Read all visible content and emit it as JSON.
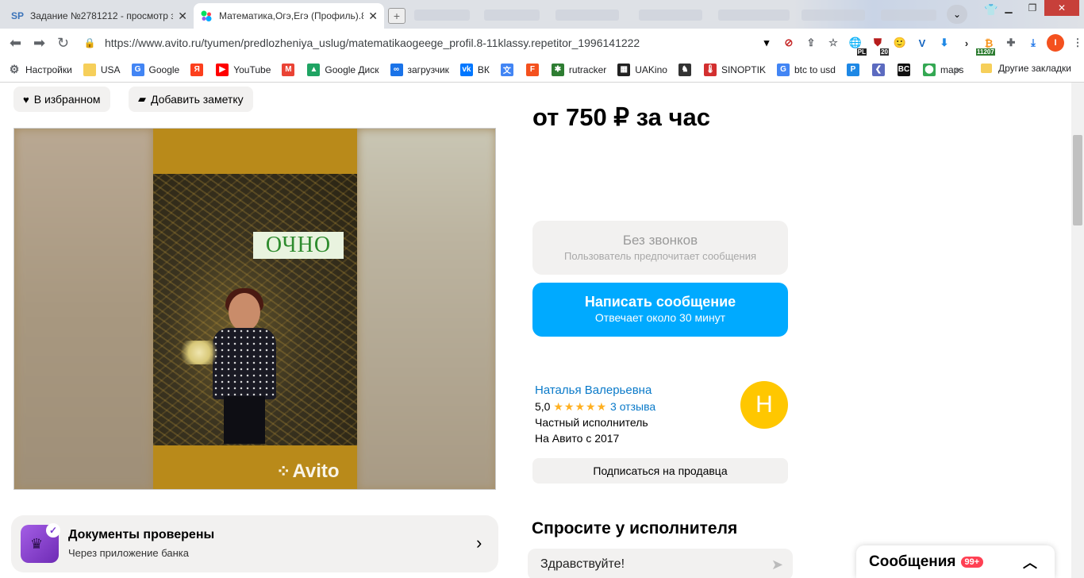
{
  "browser": {
    "tabs": [
      {
        "label": "Задание №2781212 - просмотр з",
        "favicon": "SP",
        "active": false
      },
      {
        "label": "Математика,Огэ,Егэ (Профиль).8-",
        "favicon": "avito-dots",
        "active": true
      }
    ],
    "url": "https://www.avito.ru/tyumen/predlozheniya_uslug/matematikaogeege_profil.8-11klassy.repetitor_1996141222",
    "extension_badges": {
      "pl": "PL",
      "twenty": "20",
      "count": "11207"
    },
    "profile_initial": "I",
    "bookmarks": [
      {
        "label": "Настройки",
        "icon": "gear-icon",
        "color": "#5f6368"
      },
      {
        "label": "USA",
        "icon": "folder-icon",
        "color": "#f6cf5a"
      },
      {
        "label": "Google",
        "icon": "google-icon",
        "color": "#4285f4"
      },
      {
        "label": "",
        "icon": "yandex-icon",
        "color": "#fc3f1d"
      },
      {
        "label": "YouTube",
        "icon": "youtube-icon",
        "color": "#ff0000"
      },
      {
        "label": "",
        "icon": "gmail-icon",
        "color": "#ea4335"
      },
      {
        "label": "Google Диск",
        "icon": "drive-icon",
        "color": "#1fa463"
      },
      {
        "label": "загрузчик",
        "icon": "infinity-icon",
        "color": "#1a73e8"
      },
      {
        "label": "ВК",
        "icon": "vk-icon",
        "color": "#0077ff"
      },
      {
        "label": "",
        "icon": "translate-icon",
        "color": "#4285f4"
      },
      {
        "label": "",
        "icon": "f-icon",
        "color": "#f4511e"
      },
      {
        "label": "rutracker",
        "icon": "rutracker-icon",
        "color": "#2e7d32"
      },
      {
        "label": "UAKino",
        "icon": "uakino-icon",
        "color": "#222222"
      },
      {
        "label": "",
        "icon": "chess-icon",
        "color": "#333333"
      },
      {
        "label": "SINOPTIK",
        "icon": "thermometer-icon",
        "color": "#d32f2f"
      },
      {
        "label": "btc to usd",
        "icon": "google-icon",
        "color": "#4285f4"
      },
      {
        "label": "",
        "icon": "p-icon",
        "color": "#1e88e5"
      },
      {
        "label": "",
        "icon": "chevron-left-icon",
        "color": "#5c6bc0"
      },
      {
        "label": "",
        "icon": "bc-icon",
        "color": "#111111"
      },
      {
        "label": "maps",
        "icon": "map-pin-icon",
        "color": "#34a853"
      }
    ],
    "bookmarks_more": "»",
    "other_bookmarks": "Другие закладки"
  },
  "listing": {
    "favorite_button": "В избранном",
    "note_button": "Добавить заметку",
    "photo_overlay_text": "ОЧНО",
    "watermark": "Avito",
    "price": "от 750 ₽ за час",
    "no_calls_title": "Без звонков",
    "no_calls_subtitle": "Пользователь предпочитает сообщения",
    "message_button_title": "Написать сообщение",
    "message_button_subtitle": "Отвечает около 30 минут",
    "seller": {
      "name": "Наталья Валерьевна",
      "rating": "5,0",
      "stars": "★★★★★",
      "reviews": "3 отзыва",
      "type": "Частный исполнитель",
      "since": "На Авито с 2017",
      "avatar_letter": "Н",
      "subscribe": "Подписаться на продавца"
    },
    "docs": {
      "title": "Документы проверены",
      "subtitle": "Через приложение банка"
    },
    "ask": {
      "title": "Спросите у исполнителя",
      "input_value": "Здравствуйте!"
    },
    "messenger": {
      "title": "Сообщения",
      "count": "99+"
    }
  },
  "colors": {
    "accent": "#00aaff",
    "avatar": "#ffc700",
    "link": "#0a7ac9",
    "badge": "#ff4053"
  }
}
